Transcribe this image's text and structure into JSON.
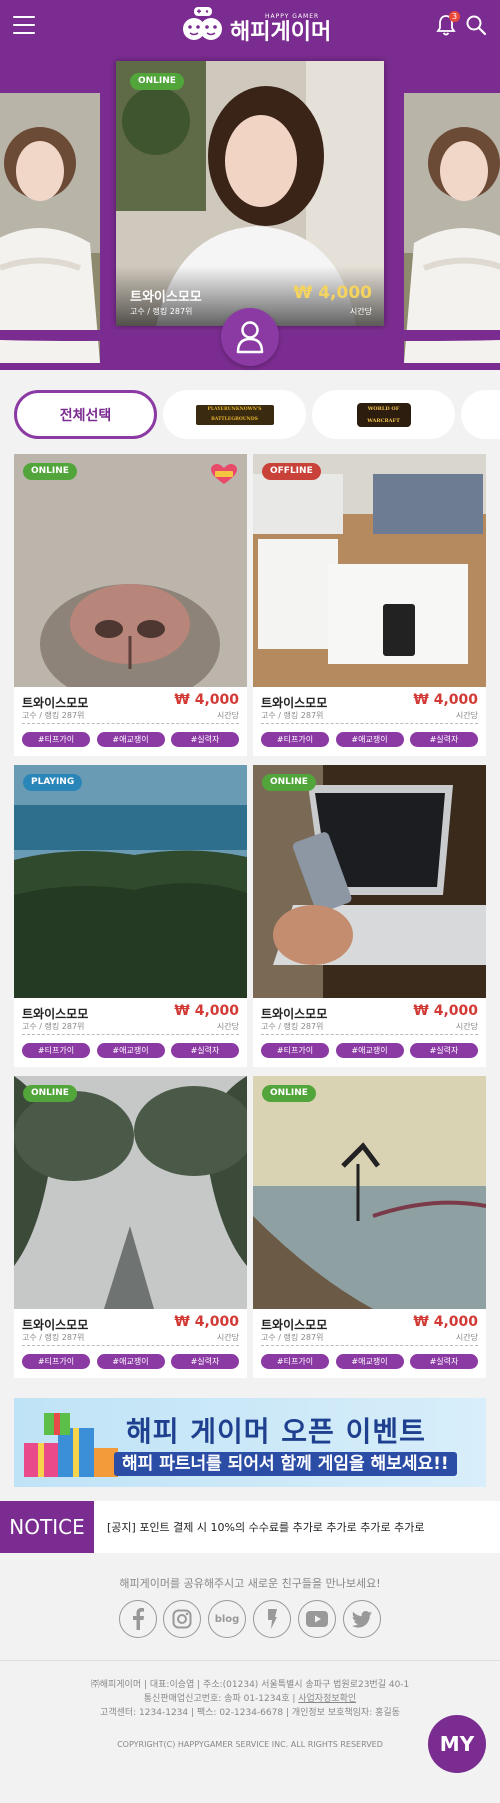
{
  "header": {
    "logo_sub": "HAPPY GAMER",
    "logo_text": "해피게이머",
    "notification_count": "3"
  },
  "hero": {
    "status": "ONLINE",
    "name": "트와이스모모",
    "rank": "고수 / 랭킹 287위",
    "price": "₩ 4,000",
    "unit": "시간당"
  },
  "categories": {
    "all_label": "전체선택",
    "pubg_label": "PLAYERUNKNOWN'S BATTLEGROUNDS",
    "wow_label": "WORLD OF WARCRAFT"
  },
  "cards": [
    {
      "status": "ONLINE",
      "name": "트와이스모모",
      "rank": "고수 / 랭킹 287위",
      "price": "₩ 4,000",
      "unit": "시간당",
      "tags": [
        "#티프가이",
        "#애교쟁이",
        "#실력자"
      ],
      "favorite": true
    },
    {
      "status": "OFFLINE",
      "name": "트와이스모모",
      "rank": "고수 / 랭킹 287위",
      "price": "₩ 4,000",
      "unit": "시간당",
      "tags": [
        "#티프가이",
        "#애교쟁이",
        "#실력자"
      ]
    },
    {
      "status": "PLAYING",
      "name": "트와이스모모",
      "rank": "고수 / 랭킹 287위",
      "price": "₩ 4,000",
      "unit": "시간당",
      "tags": [
        "#티프가이",
        "#애교쟁이",
        "#실력자"
      ]
    },
    {
      "status": "ONLINE",
      "name": "트와이스모모",
      "rank": "고수 / 랭킹 287위",
      "price": "₩ 4,000",
      "unit": "시간당",
      "tags": [
        "#티프가이",
        "#애교쟁이",
        "#실력자"
      ]
    },
    {
      "status": "ONLINE",
      "name": "트와이스모모",
      "rank": "고수 / 랭킹 287위",
      "price": "₩ 4,000",
      "unit": "시간당",
      "tags": [
        "#티프가이",
        "#애교쟁이",
        "#실력자"
      ]
    },
    {
      "status": "ONLINE",
      "name": "트와이스모모",
      "rank": "고수 / 랭킹 287위",
      "price": "₩ 4,000",
      "unit": "시간당",
      "tags": [
        "#티프가이",
        "#애교쟁이",
        "#실력자"
      ]
    }
  ],
  "banner": {
    "title": "해피 게이머 오픈 이벤트",
    "subtitle": "해피 파트너를 되어서 함께 게임을 해보세요!!"
  },
  "notice": {
    "label": "NOTICE",
    "text": "[공지] 포인트 결제 시 10%의 수수료를 추가로 추가로 추가로 추가로"
  },
  "share": {
    "text": "해피게이머를 공유해주시고 새로운 친구들을 만나보세요!",
    "blog_label": "blog"
  },
  "footer": {
    "line1": "㈜해피게이머 | 대표:이승엽 | 주소:(01234) 서울특별시 송파구 법원로23번길 40-1",
    "line2_prefix": "통신판매업신고번호: 송파 01-1234호 | ",
    "line2_link": "사업자정보확인",
    "line3": "고객센터: 1234-1234 | 팩스: 02-1234-6678 | 개인정보 보호책임자: 홍길동",
    "copyright": "COPYRIGHT(C) HAPPYGAMER SERVICE INC. ALL RIGHTS RESERVED",
    "my_label": "MY"
  },
  "colors": {
    "brand_purple": "#7b2c90",
    "accent_purple": "#8b3aa4",
    "online_green": "#51a53a",
    "offline_red": "#c9423a",
    "playing_blue": "#2a86b8",
    "price_red": "#d23a35"
  }
}
